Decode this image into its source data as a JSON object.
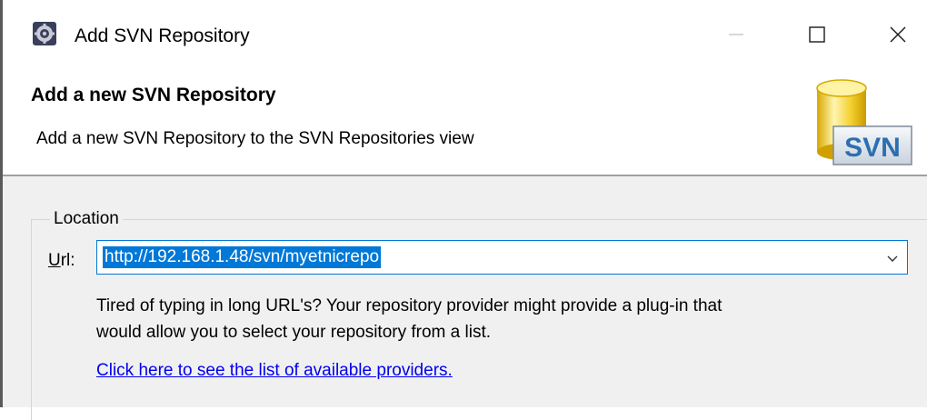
{
  "window": {
    "title": "Add SVN Repository",
    "icon": "eclipse-gear-icon",
    "controls": {
      "minimize": "minimize-icon",
      "maximize": "maximize-icon",
      "close": "close-icon"
    }
  },
  "header": {
    "title": "Add a new SVN Repository",
    "description": "Add a new SVN Repository to the SVN Repositories view",
    "graphic_label": "SVN"
  },
  "location": {
    "legend": "Location",
    "url_label_mnemonic": "U",
    "url_label_rest": "rl:",
    "url_value": "http://192.168.1.48/svn/myetnicrepo",
    "help_line1": "Tired of typing in long URL's?  Your repository provider might provide a plug-in that",
    "help_line2": "would allow you to select your repository from a list.",
    "providers_link": "Click here to see the list of available providers."
  },
  "colors": {
    "accent": "#0078d7",
    "link": "#0000ee",
    "content_bg": "#f0f0f0"
  }
}
